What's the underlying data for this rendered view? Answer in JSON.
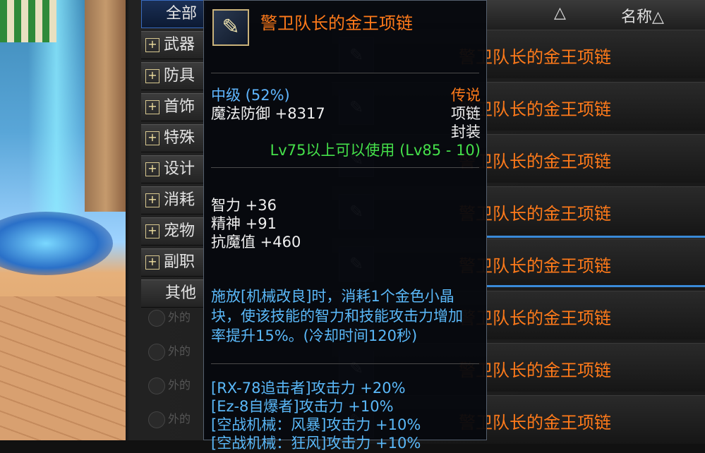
{
  "categories": [
    {
      "label": "全部",
      "expandable": false,
      "active": true
    },
    {
      "label": "武器",
      "expandable": true
    },
    {
      "label": "防具",
      "expandable": true
    },
    {
      "label": "首饰",
      "expandable": true
    },
    {
      "label": "特殊",
      "expandable": true
    },
    {
      "label": "设计",
      "expandable": true
    },
    {
      "label": "消耗",
      "expandable": true
    },
    {
      "label": "宠物",
      "expandable": true
    },
    {
      "label": "副职",
      "expandable": true
    },
    {
      "label": "其他",
      "expandable": false
    }
  ],
  "dim_rows": [
    "外的",
    "外的",
    "外的",
    "外的"
  ],
  "header": {
    "col_name": "名称△",
    "col_other": "△"
  },
  "list": {
    "item_name": "警卫队长的金王项链",
    "icon": "necklace-icon",
    "rows": 8
  },
  "tooltip": {
    "icon": "necklace-icon",
    "name": "警卫队长的金王项链",
    "grade": "中级 (52%)",
    "rarity": "传说",
    "slot": "项链",
    "seal": "封装",
    "main_stat": "魔法防御 +8317",
    "level_req": "Lv75以上可以使用 (Lv85 - 10)",
    "stats": [
      "智力 +36",
      "精神 +91",
      "抗魔值 +460"
    ],
    "description": "施放[机械改良]时，消耗1个金色小晶块，使该技能的智力和技能攻击力增加率提升15%。(冷却时间120秒)",
    "skills": [
      "[RX-78追击者]攻击力 +20%",
      "[Ez-8自爆者]攻击力 +10%",
      "[空战机械：风暴]攻击力 +10%",
      "[空战机械：狂风]攻击力 +10%"
    ]
  },
  "colors": {
    "legendary": "#ff7a1a",
    "level_req": "#45e04a",
    "stat_blue": "#5ab8f8",
    "accent": "#3a8ad8"
  }
}
